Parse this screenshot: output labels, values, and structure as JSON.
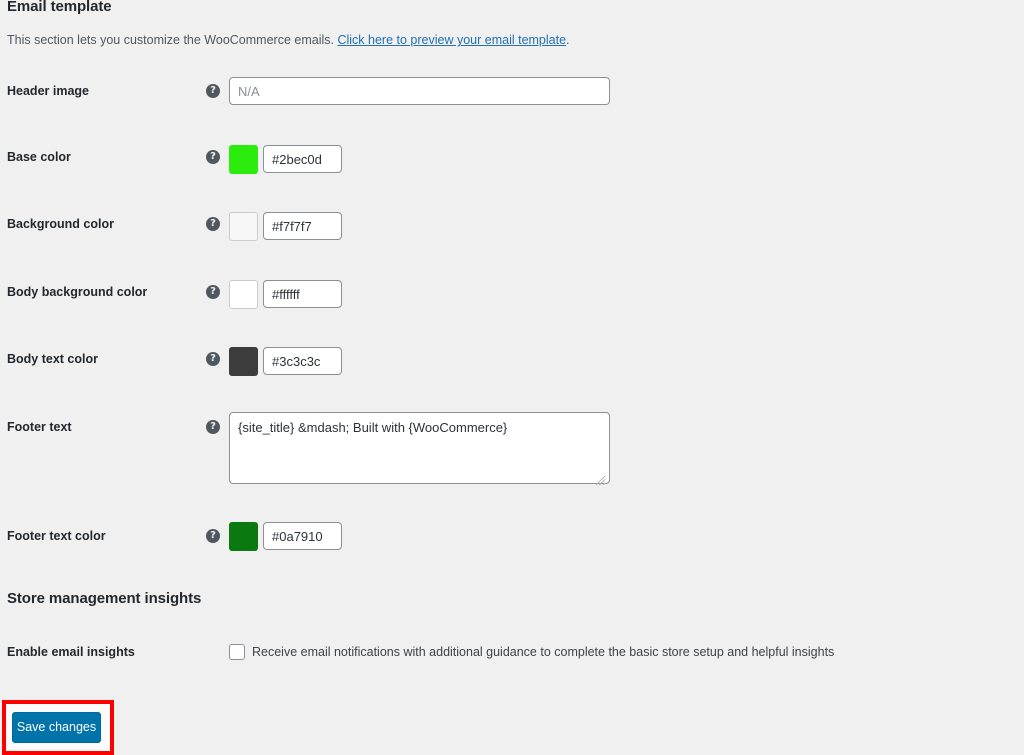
{
  "sections": {
    "email_template": {
      "title": "Email template",
      "intro_before": "This section lets you customize the WooCommerce emails.",
      "intro_link": "Click here to preview your email template",
      "intro_after": "."
    },
    "store_insights": {
      "title": "Store management insights"
    }
  },
  "help_icon": "?",
  "fields": {
    "header_image": {
      "label": "Header image",
      "value": "",
      "placeholder": "N/A",
      "help": "help-icon"
    },
    "base_color": {
      "label": "Base color",
      "value": "#2bec0d",
      "swatch": "#2bec0d"
    },
    "background_color": {
      "label": "Background color",
      "value": "#f7f7f7",
      "swatch": "#f7f7f7"
    },
    "body_background_color": {
      "label": "Body background color",
      "value": "#ffffff",
      "swatch": "#ffffff"
    },
    "body_text_color": {
      "label": "Body text color",
      "value": "#3c3c3c",
      "swatch": "#3c3c3c"
    },
    "footer_text": {
      "label": "Footer text",
      "value": "{site_title} &mdash; Built with {WooCommerce}"
    },
    "footer_text_color": {
      "label": "Footer text color",
      "value": "#0a7910",
      "swatch": "#0a7910"
    },
    "enable_email_insights": {
      "label": "Enable email insights",
      "checkbox_label": "Receive email notifications with additional guidance to complete the basic store setup and helpful insights",
      "checked": false
    }
  },
  "actions": {
    "save_label": "Save changes"
  },
  "colors": {
    "page_background": "#f0f0f1",
    "link": "#2271b1",
    "button_blue": "#0073aa",
    "annotation_red": "#ff0000"
  }
}
